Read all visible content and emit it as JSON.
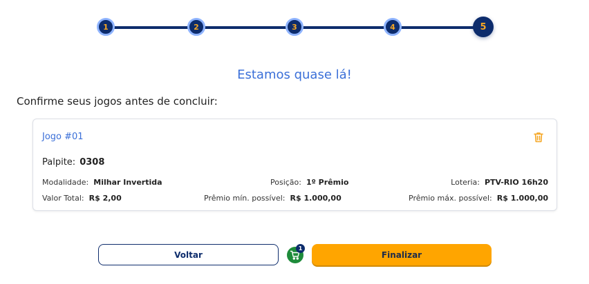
{
  "stepper": {
    "steps": [
      "1",
      "2",
      "3",
      "4",
      "5"
    ],
    "current": "5"
  },
  "headline": "Estamos quase lá!",
  "subheadline": "Confirme seus jogos antes de concluir:",
  "game": {
    "title": "Jogo #01",
    "palpite_label": "Palpite:",
    "palpite_value": "0308",
    "modalidade_label": "Modalidade:",
    "modalidade_value": "Milhar Invertida",
    "posicao_label": "Posição:",
    "posicao_value": "1º Prêmio",
    "loteria_label": "Loteria:",
    "loteria_value": "PTV-RIO 16h20",
    "valor_label": "Valor Total:",
    "valor_value": "R$ 2,00",
    "premio_min_label": "Prêmio mín. possível:",
    "premio_min_value": "R$ 1.000,00",
    "premio_max_label": "Prêmio máx. possível:",
    "premio_max_value": "R$ 1.000,00"
  },
  "actions": {
    "back_label": "Voltar",
    "finish_label": "Finalizar",
    "cart_count": "1"
  },
  "colors": {
    "primary": "#0d2c6c",
    "accent": "#ffa500",
    "link": "#3a6fd8",
    "cart": "#1e8b3a"
  }
}
